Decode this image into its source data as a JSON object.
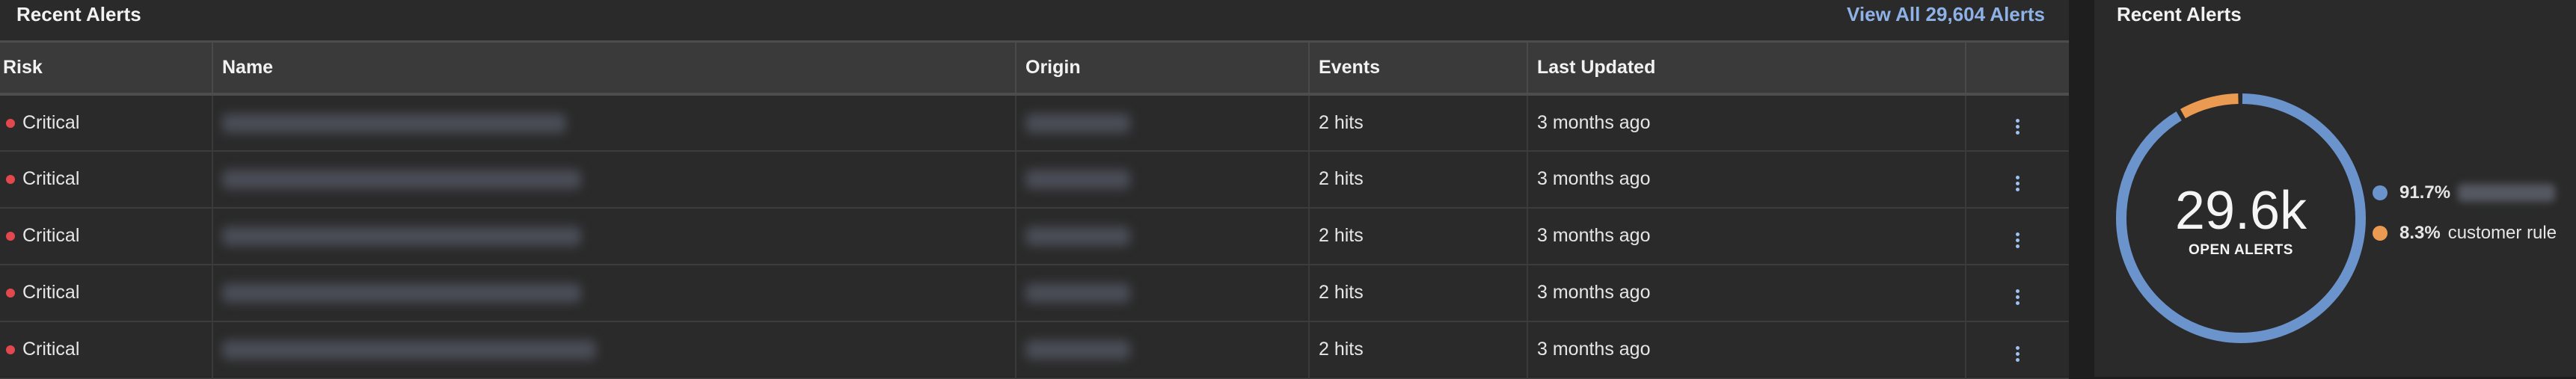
{
  "alerts_panel": {
    "title": "Recent Alerts",
    "view_all_label": "View All 29,604 Alerts",
    "columns": {
      "risk": "Risk",
      "name": "Name",
      "origin": "Origin",
      "events": "Events",
      "last_updated": "Last Updated"
    },
    "rows": [
      {
        "risk": "Critical",
        "events": "2 hits",
        "last_updated": "3 months ago"
      },
      {
        "risk": "Critical",
        "events": "2 hits",
        "last_updated": "3 months ago"
      },
      {
        "risk": "Critical",
        "events": "2 hits",
        "last_updated": "3 months ago"
      },
      {
        "risk": "Critical",
        "events": "2 hits",
        "last_updated": "3 months ago"
      },
      {
        "risk": "Critical",
        "events": "2 hits",
        "last_updated": "3 months ago"
      }
    ]
  },
  "summary_panel": {
    "title": "Recent Alerts",
    "total_value": "29.6k",
    "total_label": "OPEN ALERTS",
    "legend": [
      {
        "percent": "91.7%",
        "label": "",
        "color": "#6b93cc",
        "fraction": 0.917
      },
      {
        "percent": "8.3%",
        "label": "customer rule",
        "color": "#eb9a52",
        "fraction": 0.083
      }
    ]
  },
  "colors": {
    "critical": "#e2484e",
    "link": "#8fb2e6",
    "donut_primary": "#6b93cc",
    "donut_secondary": "#eb9a52"
  }
}
